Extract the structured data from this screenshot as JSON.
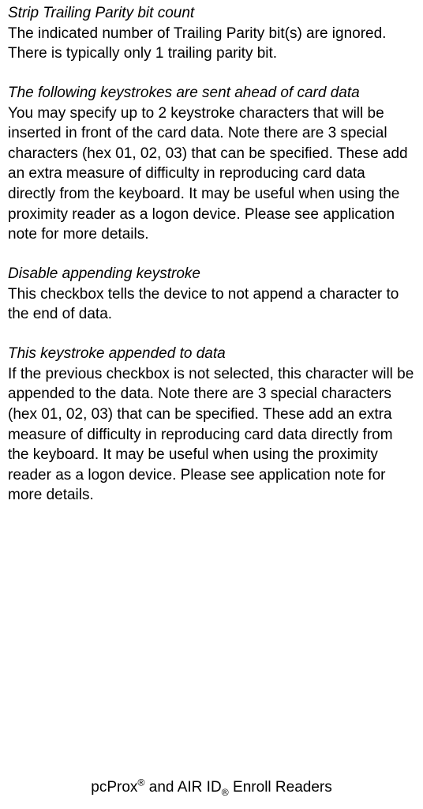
{
  "sections": {
    "s1": {
      "title": "Strip Trailing Parity bit count",
      "body": "The indicated number of Trailing Parity bit(s) are ignored. There is typically only 1 trailing parity bit."
    },
    "s2": {
      "title": "The following keystrokes are sent ahead of card data",
      "body": "You may specify up to 2 keystroke characters that will be inserted in front of the card data. Note there are 3 special characters (hex 01, 02, 03) that can be specified. These add an extra measure of difficulty in reproducing card data directly from the keyboard. It may be useful when using the proximity reader as a logon device. Please see application note for more details."
    },
    "s3": {
      "title": "Disable appending keystroke",
      "body": "This checkbox tells the device to not append a character to the end of data."
    },
    "s4": {
      "title": "This keystroke appended to data",
      "body": "If the previous checkbox is not selected, this character will be appended to the data. Note there are 3 special characters (hex 01, 02, 03) that can be specified. These add an extra measure of difficulty in reproducing card data directly from the keyboard. It may be useful when using the proximity reader as a logon device. Please see application note for more details."
    }
  },
  "footer": {
    "part1": "pcProx",
    "sup": "®",
    "part2": " and AIR ID",
    "sub": "®",
    "part3": " Enroll Readers"
  }
}
